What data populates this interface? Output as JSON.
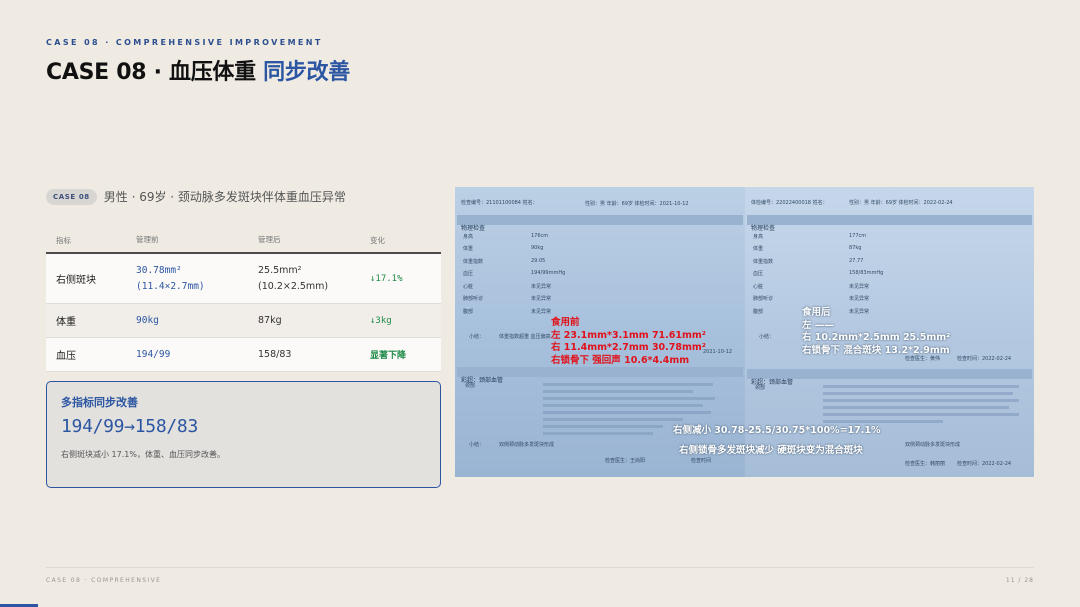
{
  "header": {
    "eyebrow": "CASE 08 · COMPREHENSIVE IMPROVEMENT",
    "title_main": "CASE 08 · 血压体重",
    "title_accent": "同步改善"
  },
  "case": {
    "badge": "CASE 08",
    "description": "男性 · 69岁 · 颈动脉多发斑块伴体重血压异常"
  },
  "table": {
    "headers": [
      "指标",
      "管理前",
      "管理后",
      "变化"
    ],
    "rows": [
      {
        "metric": "右侧斑块",
        "before_1": "30.78mm²",
        "before_2": "(11.4×2.7mm)",
        "after_1": "25.5mm²",
        "after_2": "(10.2×2.5mm)",
        "change": "↓17.1%"
      },
      {
        "metric": "体重",
        "before": "90kg",
        "after": "87kg",
        "change": "↓3kg"
      },
      {
        "metric": "血压",
        "before": "194/99",
        "after": "158/83",
        "change": "显著下降"
      }
    ]
  },
  "summary": {
    "title": "多指标同步改善",
    "value": "194/99→158/83",
    "note": "右侧斑块减小 17.1%，体重、血压同步改善。"
  },
  "report_left": {
    "id_line": "检查编号：21101100084 姓名：",
    "meta_line": "性别：男 年龄：69岁 体检时间：2021-10-12",
    "section_exam": "物理检查",
    "rows": [
      {
        "k": "身高",
        "v": "176cm"
      },
      {
        "k": "体重",
        "v": "90kg"
      },
      {
        "k": "体重指数",
        "v": "29.05"
      },
      {
        "k": "血压",
        "v": "194/99mmHg"
      },
      {
        "k": "心脏",
        "v": "未见异常"
      },
      {
        "k": "肺部听诊",
        "v": "未见异常"
      },
      {
        "k": "腹部",
        "v": "未见异常"
      }
    ],
    "summary_k": "小结：",
    "summary_v": "体重指数超重 血压偏高",
    "date": "2021-10-12",
    "section_vessel": "彩超：颈部血管",
    "vessel_k": "颈部",
    "bottom_k": "小结：",
    "bottom_v": "双侧颈动脉多发斑块形成",
    "doctor": "检查医生：王尚阳",
    "doctor_time": "检查时间"
  },
  "report_right": {
    "id_line": "体检编号：22022400018 姓名：",
    "meta_line": "性别：男 年龄：69岁 体检时间：2022-02-24",
    "section_exam": "物理检查",
    "rows": [
      {
        "k": "身高",
        "v": "177cm"
      },
      {
        "k": "体重",
        "v": "87kg"
      },
      {
        "k": "体重指数",
        "v": "27.77"
      },
      {
        "k": "血压",
        "v": "158/83mmHg"
      },
      {
        "k": "心脏",
        "v": "未见异常"
      },
      {
        "k": "肺部听诊",
        "v": "未见异常"
      },
      {
        "k": "腹部",
        "v": "未见异常"
      }
    ],
    "summary_k": "小结：",
    "doctor_mid": "检查医生：黄伟",
    "time_mid": "检查时间：2022-02-24",
    "section_vessel": "彩超：颈部血管",
    "vessel_k": "颈部",
    "bottom_v": "双侧颈动脉多发斑块形成",
    "doctor": "检查医生：韩丽丽",
    "doctor_time": "检查时间：2022-02-24"
  },
  "annotations": {
    "before_title": "食用前",
    "before_line1": "左 23.1mm*3.1mm  71.61mm²",
    "before_line2": "右 11.4mm*2.7mm  30.78mm²",
    "before_line3": "右锁骨下 强回声 10.6*4.4mm",
    "after_title": "食用后",
    "after_line1": "左 ——",
    "after_line2": "右 10.2mm*2.5mm  25.5mm²",
    "after_line3": "右锁骨下 混合斑块 13.2*2.9mm",
    "calc_line": "右侧减小  30.78-25.5/30.75*100%=17.1%",
    "conclusion": "右侧锁骨多发斑块减少 硬斑块变为混合斑块"
  },
  "footer": {
    "left": "CASE 08 · COMPREHENSIVE",
    "page": "11 / 28"
  },
  "colors": {
    "accent": "#2c56a2",
    "positive": "#1e8a48",
    "annotation_red": "#e1121b"
  }
}
